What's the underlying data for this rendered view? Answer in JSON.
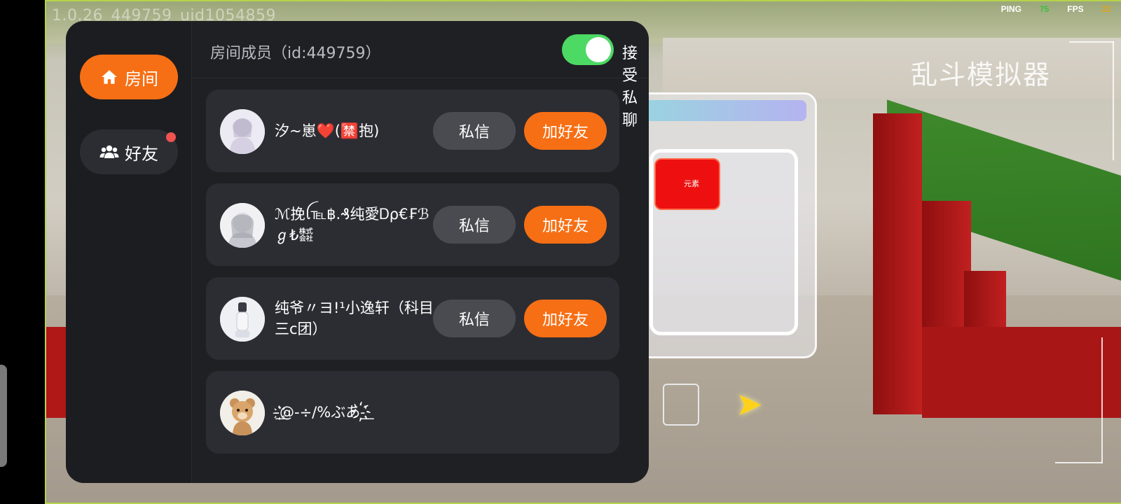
{
  "hud": {
    "version": "1.0.26_449759_uid1054859",
    "ping_label": "PING",
    "ping_value": "75",
    "fps_label": "FPS",
    "fps_value": "22",
    "game_title": "乱斗模拟器",
    "scene_tag": "元素"
  },
  "sidebar": {
    "tabs": [
      {
        "label": "房间",
        "icon": "home-icon",
        "active": true
      },
      {
        "label": "好友",
        "icon": "people-icon",
        "active": false,
        "has_badge": true
      }
    ]
  },
  "header": {
    "title": "房间成员（id:449759）",
    "private_chat_label": "接受私聊",
    "private_chat_enabled": true
  },
  "members": [
    {
      "name": "汐~崽❤️(🈲抱)",
      "dm_label": "私信",
      "add_label": "加好友"
    },
    {
      "name": "ℳ挽ꪶ℡฿.₰纯愛Ꭰρ€₣ℬℊ₺㍿",
      "dm_label": "私信",
      "add_label": "加好友"
    },
    {
      "name": "纯爷〃ヨ!¹小逸轩（科目三c团）",
      "dm_label": "私信",
      "add_label": "加好友"
    },
    {
      "name": "-͛͟҉@-÷/%ぶあ-͛͟҉",
      "dm_label": "",
      "add_label": ""
    }
  ],
  "colors": {
    "accent": "#f76f14",
    "toggle_on": "#4cd964",
    "badge": "#ef5350",
    "dialog_bg": "#1f2024",
    "card_bg": "#2c2d33"
  }
}
